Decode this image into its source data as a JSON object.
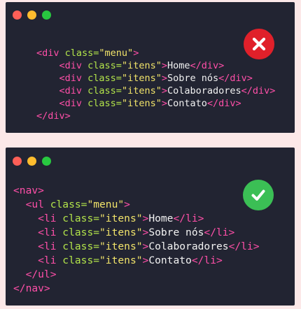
{
  "colors": {
    "background": "#fce8e8",
    "panel": "#222432",
    "tag": "#ff4fa8",
    "attribute": "#b2e34a",
    "string": "#f2e46a",
    "text": "#f2f2f2",
    "bad_badge": "#e0202a",
    "good_badge": "#3bbf55"
  },
  "bad_example": {
    "status_icon": "x-mark-icon",
    "lines": [
      [
        {
          "t": "tag",
          "v": "<div "
        },
        {
          "t": "attr",
          "v": "class="
        },
        {
          "t": "str",
          "v": "\"menu\""
        },
        {
          "t": "tag",
          "v": ">"
        }
      ],
      [
        {
          "t": "tag",
          "v": "    <div "
        },
        {
          "t": "attr",
          "v": "class="
        },
        {
          "t": "str",
          "v": "\"itens\""
        },
        {
          "t": "tag",
          "v": ">"
        },
        {
          "t": "txt",
          "v": "Home"
        },
        {
          "t": "tag",
          "v": "</div>"
        }
      ],
      [
        {
          "t": "tag",
          "v": "    <div "
        },
        {
          "t": "attr",
          "v": "class="
        },
        {
          "t": "str",
          "v": "\"itens\""
        },
        {
          "t": "tag",
          "v": ">"
        },
        {
          "t": "txt",
          "v": "Sobre nós"
        },
        {
          "t": "tag",
          "v": "</div>"
        }
      ],
      [
        {
          "t": "tag",
          "v": "    <div "
        },
        {
          "t": "attr",
          "v": "class="
        },
        {
          "t": "str",
          "v": "\"itens\""
        },
        {
          "t": "tag",
          "v": ">"
        },
        {
          "t": "txt",
          "v": "Colaboradores"
        },
        {
          "t": "tag",
          "v": "</div>"
        }
      ],
      [
        {
          "t": "tag",
          "v": "    <div "
        },
        {
          "t": "attr",
          "v": "class="
        },
        {
          "t": "str",
          "v": "\"itens\""
        },
        {
          "t": "tag",
          "v": ">"
        },
        {
          "t": "txt",
          "v": "Contato"
        },
        {
          "t": "tag",
          "v": "</div>"
        }
      ],
      [
        {
          "t": "tag",
          "v": "</div>"
        }
      ]
    ]
  },
  "good_example": {
    "status_icon": "check-mark-icon",
    "lines": [
      [
        {
          "t": "tag",
          "v": "<nav>"
        }
      ],
      [
        {
          "t": "tag",
          "v": "  <ul "
        },
        {
          "t": "attr",
          "v": "class="
        },
        {
          "t": "str",
          "v": "\"menu\""
        },
        {
          "t": "tag",
          "v": ">"
        }
      ],
      [
        {
          "t": "tag",
          "v": "    <li "
        },
        {
          "t": "attr",
          "v": "class="
        },
        {
          "t": "str",
          "v": "\"itens\""
        },
        {
          "t": "tag",
          "v": ">"
        },
        {
          "t": "txt",
          "v": "Home"
        },
        {
          "t": "tag",
          "v": "</li>"
        }
      ],
      [
        {
          "t": "tag",
          "v": "    <li "
        },
        {
          "t": "attr",
          "v": "class="
        },
        {
          "t": "str",
          "v": "\"itens\""
        },
        {
          "t": "tag",
          "v": ">"
        },
        {
          "t": "txt",
          "v": "Sobre nós"
        },
        {
          "t": "tag",
          "v": "</li>"
        }
      ],
      [
        {
          "t": "tag",
          "v": "    <li "
        },
        {
          "t": "attr",
          "v": "class="
        },
        {
          "t": "str",
          "v": "\"itens\""
        },
        {
          "t": "tag",
          "v": ">"
        },
        {
          "t": "txt",
          "v": "Colaboradores"
        },
        {
          "t": "tag",
          "v": "</li>"
        }
      ],
      [
        {
          "t": "tag",
          "v": "    <li "
        },
        {
          "t": "attr",
          "v": "class="
        },
        {
          "t": "str",
          "v": "\"itens\""
        },
        {
          "t": "tag",
          "v": ">"
        },
        {
          "t": "txt",
          "v": "Contato"
        },
        {
          "t": "tag",
          "v": "</li>"
        }
      ],
      [
        {
          "t": "tag",
          "v": "  </ul>"
        }
      ],
      [
        {
          "t": "tag",
          "v": "</nav>"
        }
      ]
    ]
  }
}
